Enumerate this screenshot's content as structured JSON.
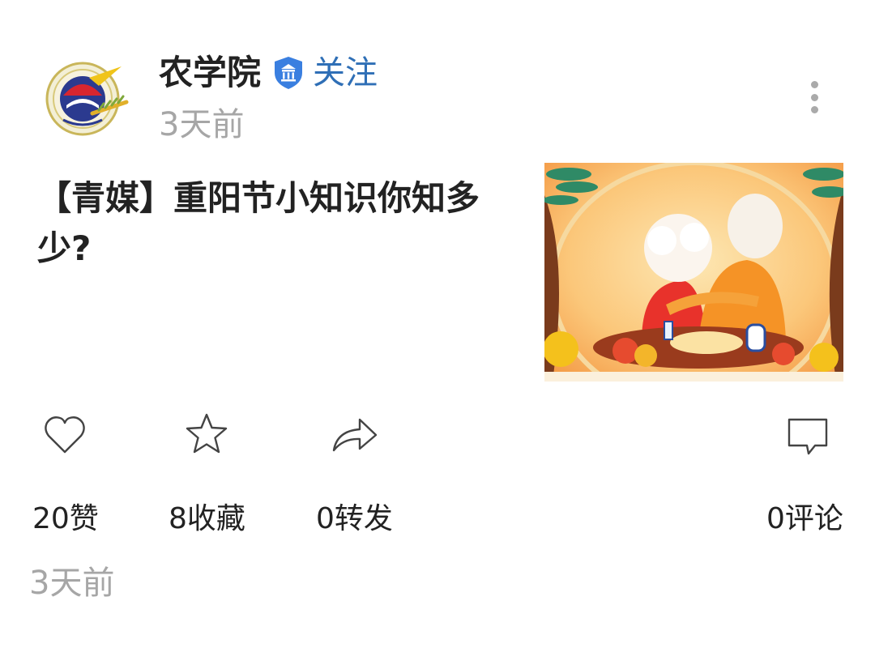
{
  "header": {
    "account_name": "农学院",
    "verified_icon": "verified-institution-icon",
    "follow_label": "关注",
    "time": "3天前",
    "more_icon": "more-vertical-icon",
    "colors": {
      "follow": "#2f6fb6",
      "verified_badge": "#3a7fe0",
      "muted_text": "#a6a6a6"
    }
  },
  "post": {
    "title": "【青媒】重阳节小知识你知多少?",
    "thumbnail_icon": "double-ninth-festival-illustration"
  },
  "actions": {
    "like": {
      "icon": "heart-icon",
      "count_label": "20赞"
    },
    "favorite": {
      "icon": "star-icon",
      "count_label": "8收藏"
    },
    "share": {
      "icon": "share-arrow-icon",
      "count_label": "0转发"
    },
    "comment": {
      "icon": "comment-bubble-icon",
      "count_label": "0评论"
    }
  },
  "footer": {
    "time": "3天前"
  }
}
